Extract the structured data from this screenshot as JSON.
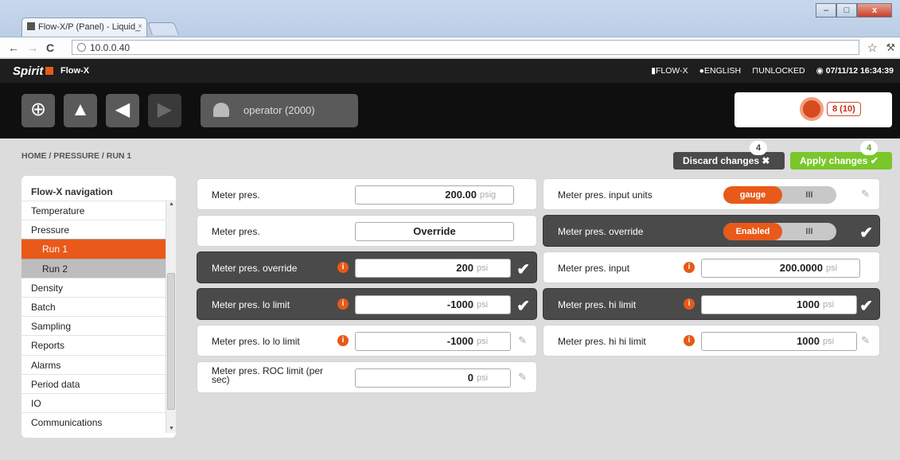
{
  "browser": {
    "tab_title": "Flow-X/P (Panel) - Liquid_",
    "tab_close": "×",
    "url": "10.0.0.40",
    "window_min": "–",
    "window_max": "□",
    "window_close": "x"
  },
  "app": {
    "logo": "Spirit",
    "name": "Flow-X",
    "status_device": "FLOW-X",
    "status_language": "ENGLISH",
    "status_lock": "UNLOCKED",
    "datetime": "07/11/12 16:34:39"
  },
  "toolbar": {
    "user": "operator (2000)",
    "alarm_count": "8 (10)"
  },
  "breadcrumb": "HOME / PRESSURE / RUN 1",
  "actions": {
    "discard_label": "Discard changes",
    "discard_count": "4",
    "apply_label": "Apply changes",
    "apply_count": "4"
  },
  "sidebar": {
    "title": "Flow-X navigation",
    "items": [
      {
        "label": "Temperature"
      },
      {
        "label": "Pressure"
      },
      {
        "label": "Run 1"
      },
      {
        "label": "Run 2"
      },
      {
        "label": "Density"
      },
      {
        "label": "Batch"
      },
      {
        "label": "Sampling"
      },
      {
        "label": "Reports"
      },
      {
        "label": "Alarms"
      },
      {
        "label": "Period data"
      },
      {
        "label": "IO"
      },
      {
        "label": "Communications"
      }
    ]
  },
  "left_rows": [
    {
      "label": "Meter pres.",
      "value": "200.00",
      "unit": "psig"
    },
    {
      "label": "Meter pres.",
      "value": "Override"
    },
    {
      "label": "Meter pres. override",
      "value": "200",
      "unit": "psi"
    },
    {
      "label": "Meter pres. lo limit",
      "value": "-1000",
      "unit": "psi"
    },
    {
      "label": "Meter pres. lo lo limit",
      "value": "-1000",
      "unit": "psi"
    },
    {
      "label": "Meter pres. ROC limit (per sec)",
      "value": "0",
      "unit": "psi"
    }
  ],
  "right_rows": [
    {
      "label": "Meter pres. input units",
      "toggle_on": "gauge",
      "toggle_off": "III"
    },
    {
      "label": "Meter pres. override",
      "toggle_on": "Enabled",
      "toggle_off": "III"
    },
    {
      "label": "Meter pres. input",
      "value": "200.0000",
      "unit": "psi"
    },
    {
      "label": "Meter pres. hi limit",
      "value": "1000",
      "unit": "psi"
    },
    {
      "label": "Meter pres. hi hi limit",
      "value": "1000",
      "unit": "psi"
    }
  ],
  "colors": {
    "accent": "#e8591a",
    "apply": "#7ac72a",
    "dark_row": "#4a4a4a"
  }
}
